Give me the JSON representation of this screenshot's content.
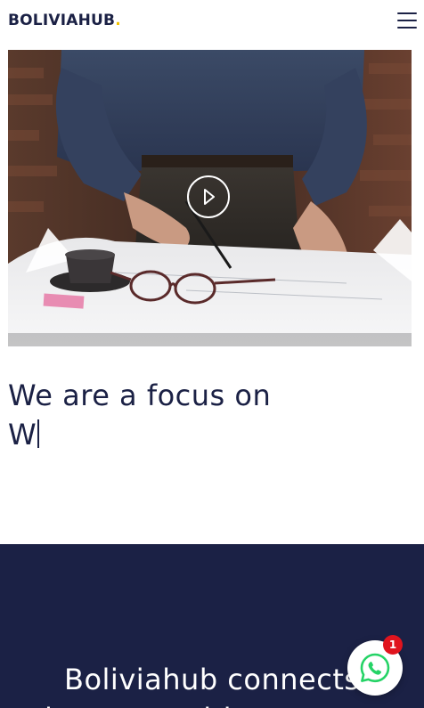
{
  "header": {
    "logo_text": "BOLIVIAHUB",
    "logo_dot": ".",
    "menu_icon": "hamburger-menu-icon"
  },
  "hero": {
    "play_icon": "play-icon"
  },
  "headline": {
    "line1": "We are a focus on",
    "typed_text": "W"
  },
  "dark_section": {
    "title_line1": "Boliviahub connects",
    "title_line2": "journeys with great"
  },
  "whatsapp": {
    "icon": "whatsapp-icon",
    "badge_count": "1"
  },
  "colors": {
    "navy": "#1b2145",
    "accent_yellow": "#f2c200",
    "whatsapp_green": "#25d366",
    "badge_red": "#e0141e"
  }
}
